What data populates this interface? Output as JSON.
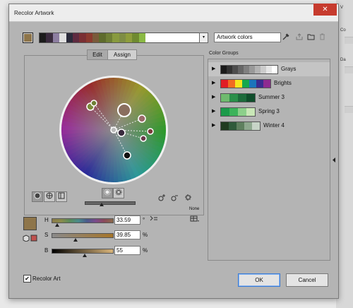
{
  "dialog": {
    "title": "Recolor Artwork",
    "close_glyph": "✕"
  },
  "background": {
    "right_labels": [
      "V",
      "Co",
      "Da"
    ]
  },
  "top": {
    "current_color": "#8e754a",
    "strip_colors": [
      "#1b1b1b",
      "#3a2b3e",
      "#8d7ea1",
      "#e0e0e0",
      "#2a2a3a",
      "#5e2a40",
      "#7a2f33",
      "#8b3a2f",
      "#7a5a3a",
      "#5e6b2c",
      "#6f7f35",
      "#889a3e",
      "#7e8d44",
      "#8e9d3c",
      "#6f8a30",
      "#8ab944"
    ],
    "art_name": "Artwork colors",
    "dropdown_glyph": "▾",
    "icons": [
      "eyedropper-icon",
      "save-group-icon",
      "folder-icon",
      "trash-icon"
    ]
  },
  "tabs": {
    "edit": "Edit",
    "assign": "Assign"
  },
  "color_groups": {
    "label": "Color Groups",
    "items": [
      {
        "name": "Grays",
        "colors": [
          "#1a1a1a",
          "#333",
          "#4d4d4d",
          "#666",
          "#808080",
          "#999",
          "#b3b3b3",
          "#ccc",
          "#e6e6e6",
          "#fff"
        ]
      },
      {
        "name": "Brights",
        "colors": [
          "#e11d24",
          "#f26b21",
          "#f6e61e",
          "#13a84c",
          "#1b75bb",
          "#3b2c8f",
          "#8e2a90"
        ]
      },
      {
        "name": "Summer 3",
        "colors": [
          "#6fba6e",
          "#2a8f4a",
          "#1c6b3b",
          "#0f4d2b"
        ]
      },
      {
        "name": "Spring 3",
        "colors": [
          "#1b9a4a",
          "#3cb35a",
          "#8cd08a",
          "#c9e7b7"
        ]
      },
      {
        "name": "Winter 4",
        "colors": [
          "#1f3b1f",
          "#2f5a3a",
          "#5e7f5e",
          "#8ea88e",
          "#c7d4c7"
        ]
      }
    ]
  },
  "sliders": {
    "h": {
      "label": "H",
      "value": "33.59",
      "unit": "°",
      "fraction": 0.093
    },
    "s": {
      "label": "S",
      "value": "39.85",
      "unit": "%",
      "fraction": 0.3985
    },
    "b": {
      "label": "B",
      "value": "55",
      "unit": "%",
      "fraction": 0.55
    }
  },
  "none_label": "None",
  "recolor_art": {
    "label": "Recolor Art",
    "checked": true,
    "check_glyph": "✔"
  },
  "buttons": {
    "ok": "OK",
    "cancel": "Cancel"
  },
  "colors": {
    "accent": "#3a7bd5",
    "close_red": "#c63b2e"
  }
}
